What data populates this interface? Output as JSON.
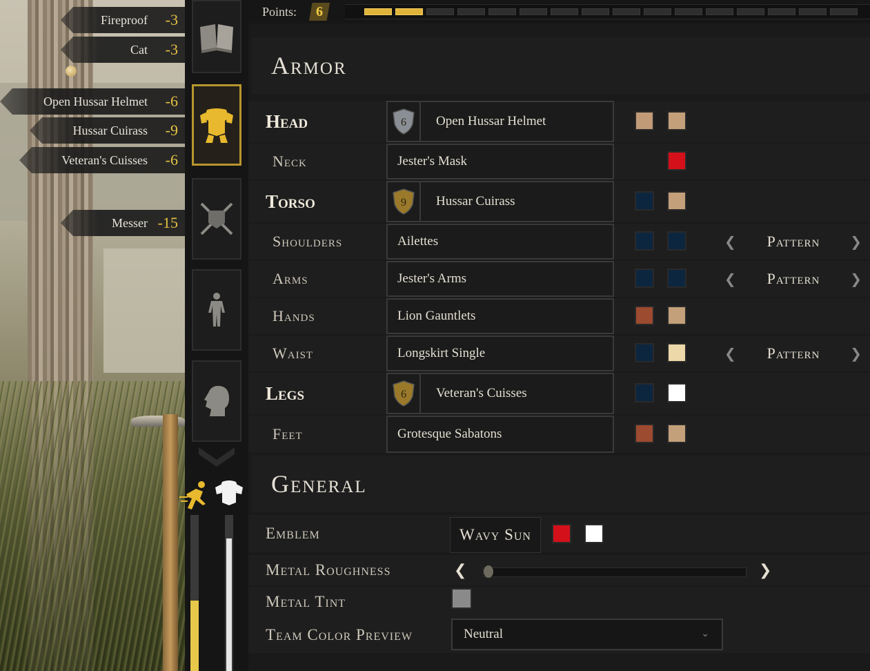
{
  "perks": [
    {
      "name": "Fireproof",
      "value": "-3"
    },
    {
      "name": "Cat",
      "value": "-3"
    },
    {
      "name": "Open Hussar Helmet",
      "value": "-6"
    },
    {
      "name": "Hussar Cuirass",
      "value": "-9"
    },
    {
      "name": "Veteran's Cuisses",
      "value": "-6"
    },
    {
      "name": "Messer",
      "value": "-15"
    }
  ],
  "sidebar": {
    "tabs": [
      {
        "icon": "book-icon",
        "active": false
      },
      {
        "icon": "armor-icon",
        "active": true
      },
      {
        "icon": "crossed-swords-icon",
        "active": false
      },
      {
        "icon": "body-icon",
        "active": false
      },
      {
        "icon": "head-icon",
        "active": false
      }
    ],
    "stamina_fraction": 0.45,
    "armor_fraction": 0.85
  },
  "points": {
    "label": "Points:",
    "value": "6",
    "segments_total": 16,
    "segments_filled": 2
  },
  "armor": {
    "title": "Armor",
    "rows": [
      {
        "label": "Head",
        "major": true,
        "item": "Open Hussar Helmet",
        "cost": "6",
        "colors": [
          "#c19a78",
          "#c4a07a"
        ],
        "pattern": null
      },
      {
        "label": "Neck",
        "major": false,
        "item": "Jester's Mask",
        "cost": null,
        "colors": [
          null,
          "#d4101a"
        ],
        "pattern": null
      },
      {
        "label": "Torso",
        "major": true,
        "item": "Hussar Cuirass",
        "cost": "9",
        "colors": [
          "#0c2640",
          "#c4a07a"
        ],
        "pattern": null
      },
      {
        "label": "Shoulders",
        "major": false,
        "item": "Ailettes",
        "cost": null,
        "colors": [
          "#0c2640",
          "#0c2640"
        ],
        "pattern": "Pattern"
      },
      {
        "label": "Arms",
        "major": false,
        "item": "Jester's Arms",
        "cost": null,
        "colors": [
          "#0c2640",
          "#0c2640"
        ],
        "pattern": "Pattern"
      },
      {
        "label": "Hands",
        "major": false,
        "item": "Lion Gauntlets",
        "cost": null,
        "colors": [
          "#9c4a30",
          "#c4a07a"
        ],
        "pattern": null
      },
      {
        "label": "Waist",
        "major": false,
        "item": "Longskirt Single",
        "cost": null,
        "colors": [
          "#0c2640",
          "#ecd8a8"
        ],
        "pattern": "Pattern"
      },
      {
        "label": "Legs",
        "major": true,
        "item": "Veteran's Cuisses",
        "cost": "6",
        "colors": [
          "#0c2640",
          "#ffffff"
        ],
        "pattern": null
      },
      {
        "label": "Feet",
        "major": false,
        "item": "Grotesque Sabatons",
        "cost": null,
        "colors": [
          "#9c4a30",
          "#c4a07a"
        ],
        "pattern": null
      }
    ]
  },
  "general": {
    "title": "General",
    "emblem": {
      "label": "Emblem",
      "value": "Wavy Sun",
      "colors": [
        "#d4101a",
        "#ffffff"
      ]
    },
    "metal_roughness": {
      "label": "Metal Roughness",
      "value": 0.0
    },
    "metal_tint": {
      "label": "Metal Tint",
      "color": "#8a8a8a"
    },
    "team_color_preview": {
      "label": "Team Color Preview",
      "value": "Neutral"
    }
  },
  "colors": {
    "accent_gold": "#e0b43a",
    "silver_shield": "#8a8f96",
    "gold_shield": "#9a7a2a"
  }
}
